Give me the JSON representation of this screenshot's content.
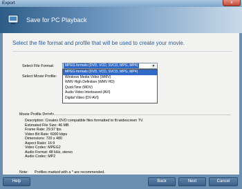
{
  "window": {
    "title": "Export",
    "close_label": "x"
  },
  "header": {
    "title": "Save for PC Playback",
    "logo_icon": "export-wizard-icon"
  },
  "main": {
    "subtitle": "Select the file format and profile that will be used to create your movie.",
    "file_format_label": "Select File Format:",
    "movie_profile_label": "Select Movie Profile:",
    "file_format_selected": "MPEG formats (DVD, VCD, SVCD, MPG, MP4)",
    "file_format_options": [
      "MPEG formats (DVD, VCD, SVCD, MPG, MP4)",
      "Windows Media Video (WMV)",
      "WMV High Definition (WMV HD)",
      "QuickTime (MOV)",
      "Audio Video Interleaved (AVI)",
      "Digital Video (DV-AVI)"
    ]
  },
  "details": {
    "section_title": "Movie Profile Details",
    "lines": [
      "Description: Creates DVD compatible files formatted to fit widescreen TV.",
      "Estimated File Size: 46 MB",
      "Frame Rate: 29.97 fps",
      "Video Bit Rate: 6000 kbps",
      "Dimensions: 720 x 480",
      "Aspect Ratio: 16:9",
      "Video Codec: MPEG2",
      "Audio Format: 48 kHz, stereo",
      "Audio Codec: MP2"
    ],
    "note_label": "Note:",
    "note_text": "Profiles marked with a * are recommended."
  },
  "footer": {
    "help": "Help",
    "back": "Back",
    "next": "Next",
    "cancel": "Cancel"
  }
}
